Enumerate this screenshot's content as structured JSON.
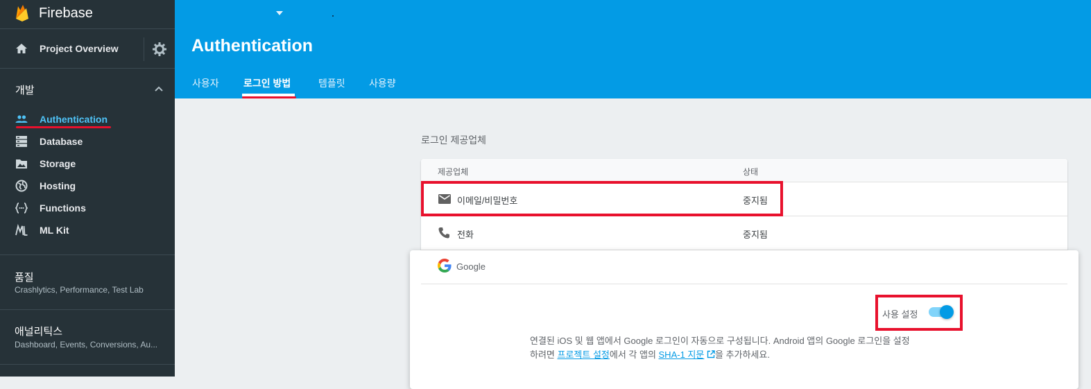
{
  "sidebar": {
    "brand": "Firebase",
    "overview_label": "Project Overview",
    "develop_title": "개발",
    "items": [
      {
        "label": "Authentication",
        "icon": "people-icon"
      },
      {
        "label": "Database",
        "icon": "database-icon"
      },
      {
        "label": "Storage",
        "icon": "storage-icon"
      },
      {
        "label": "Hosting",
        "icon": "globe-icon"
      },
      {
        "label": "Functions",
        "icon": "functions-icon"
      },
      {
        "label": "ML Kit",
        "icon": "mlkit-icon"
      }
    ],
    "quality": {
      "title": "품질",
      "subtitle": "Crashlytics, Performance, Test Lab"
    },
    "analytics": {
      "title": "애널리틱스",
      "subtitle": "Dashboard, Events, Conversions, Au..."
    }
  },
  "header": {
    "title": "Authentication",
    "tabs": [
      "사용자",
      "로그인 방법",
      "템플릿",
      "사용량"
    ]
  },
  "providers": {
    "section_label": "로그인 제공업체",
    "col_provider": "제공업체",
    "col_status": "상태",
    "rows": [
      {
        "name": "이메일/비밀번호",
        "status": "중지됨",
        "icon": "mail-icon"
      },
      {
        "name": "전화",
        "status": "중지됨",
        "icon": "phone-icon"
      }
    ]
  },
  "google": {
    "name": "Google",
    "enable_label": "사용 설정",
    "enabled": true,
    "desc_line1": "연결된 iOS 및 웹 앱에서 Google 로그인이 자동으로 구성됩니다. Android 앱의 Google 로그인을 설정",
    "desc_prefix": "하려면 ",
    "desc_link1": "프로젝트 설정",
    "desc_mid": "에서 각 앱의 ",
    "desc_link2": "SHA-1 지문",
    "desc_suffix": "을 추가하세요."
  },
  "colors": {
    "header_bg": "#039be5",
    "sidebar_bg": "#263238",
    "active_link": "#4fc3f7",
    "highlight_red": "#e8112d"
  }
}
